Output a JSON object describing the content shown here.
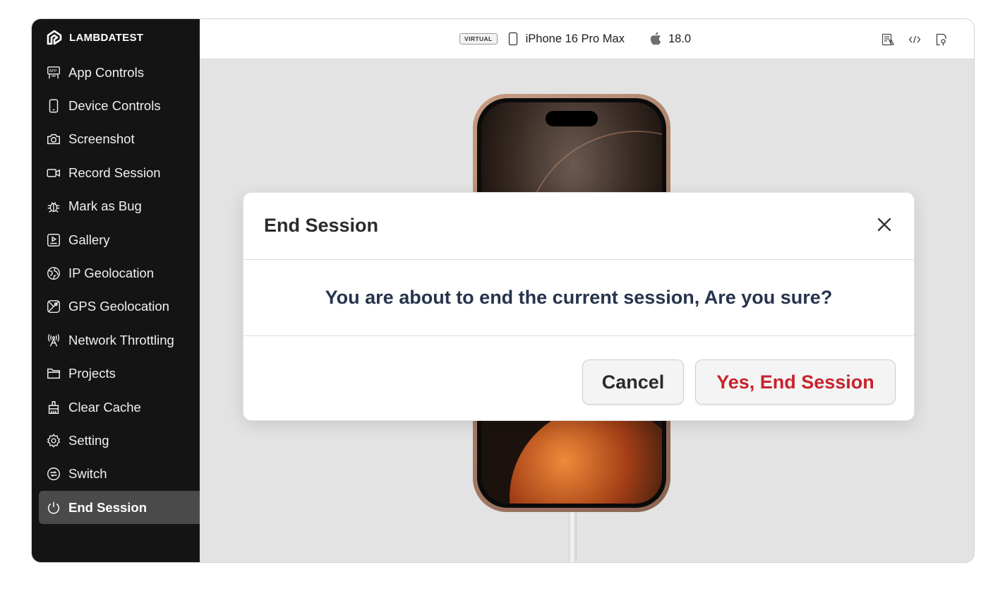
{
  "brand": {
    "name": "LAMBDATEST"
  },
  "sidebar": {
    "items": [
      {
        "label": "App Controls",
        "icon": "app-icon"
      },
      {
        "label": "Device Controls",
        "icon": "phone-icon"
      },
      {
        "label": "Screenshot",
        "icon": "camera-icon"
      },
      {
        "label": "Record Session",
        "icon": "video-icon"
      },
      {
        "label": "Mark as Bug",
        "icon": "bug-icon"
      },
      {
        "label": "Gallery",
        "icon": "gallery-icon"
      },
      {
        "label": "IP Geolocation",
        "icon": "globe-icon"
      },
      {
        "label": "GPS Geolocation",
        "icon": "map-icon"
      },
      {
        "label": "Network Throttling",
        "icon": "antenna-icon"
      },
      {
        "label": "Projects",
        "icon": "folder-icon"
      },
      {
        "label": "Clear Cache",
        "icon": "broom-icon"
      },
      {
        "label": "Setting",
        "icon": "gear-icon"
      },
      {
        "label": "Switch",
        "icon": "switch-icon"
      },
      {
        "label": "End Session",
        "icon": "power-icon",
        "active": true
      }
    ]
  },
  "header": {
    "badge": "VIRTUAL",
    "device_name": "iPhone 16 Pro Max",
    "os_version": "18.0",
    "icons": [
      "logs-icon",
      "code-icon",
      "inspect-icon"
    ]
  },
  "modal": {
    "title": "End Session",
    "message": "You are about to end the current session, Are you sure?",
    "cancel_label": "Cancel",
    "confirm_label": "Yes, End Session"
  },
  "colors": {
    "sidebar_bg": "#141414",
    "active_item_bg": "#4a4a4a",
    "confirm_text": "#c8222c",
    "message_text": "#26344c"
  }
}
